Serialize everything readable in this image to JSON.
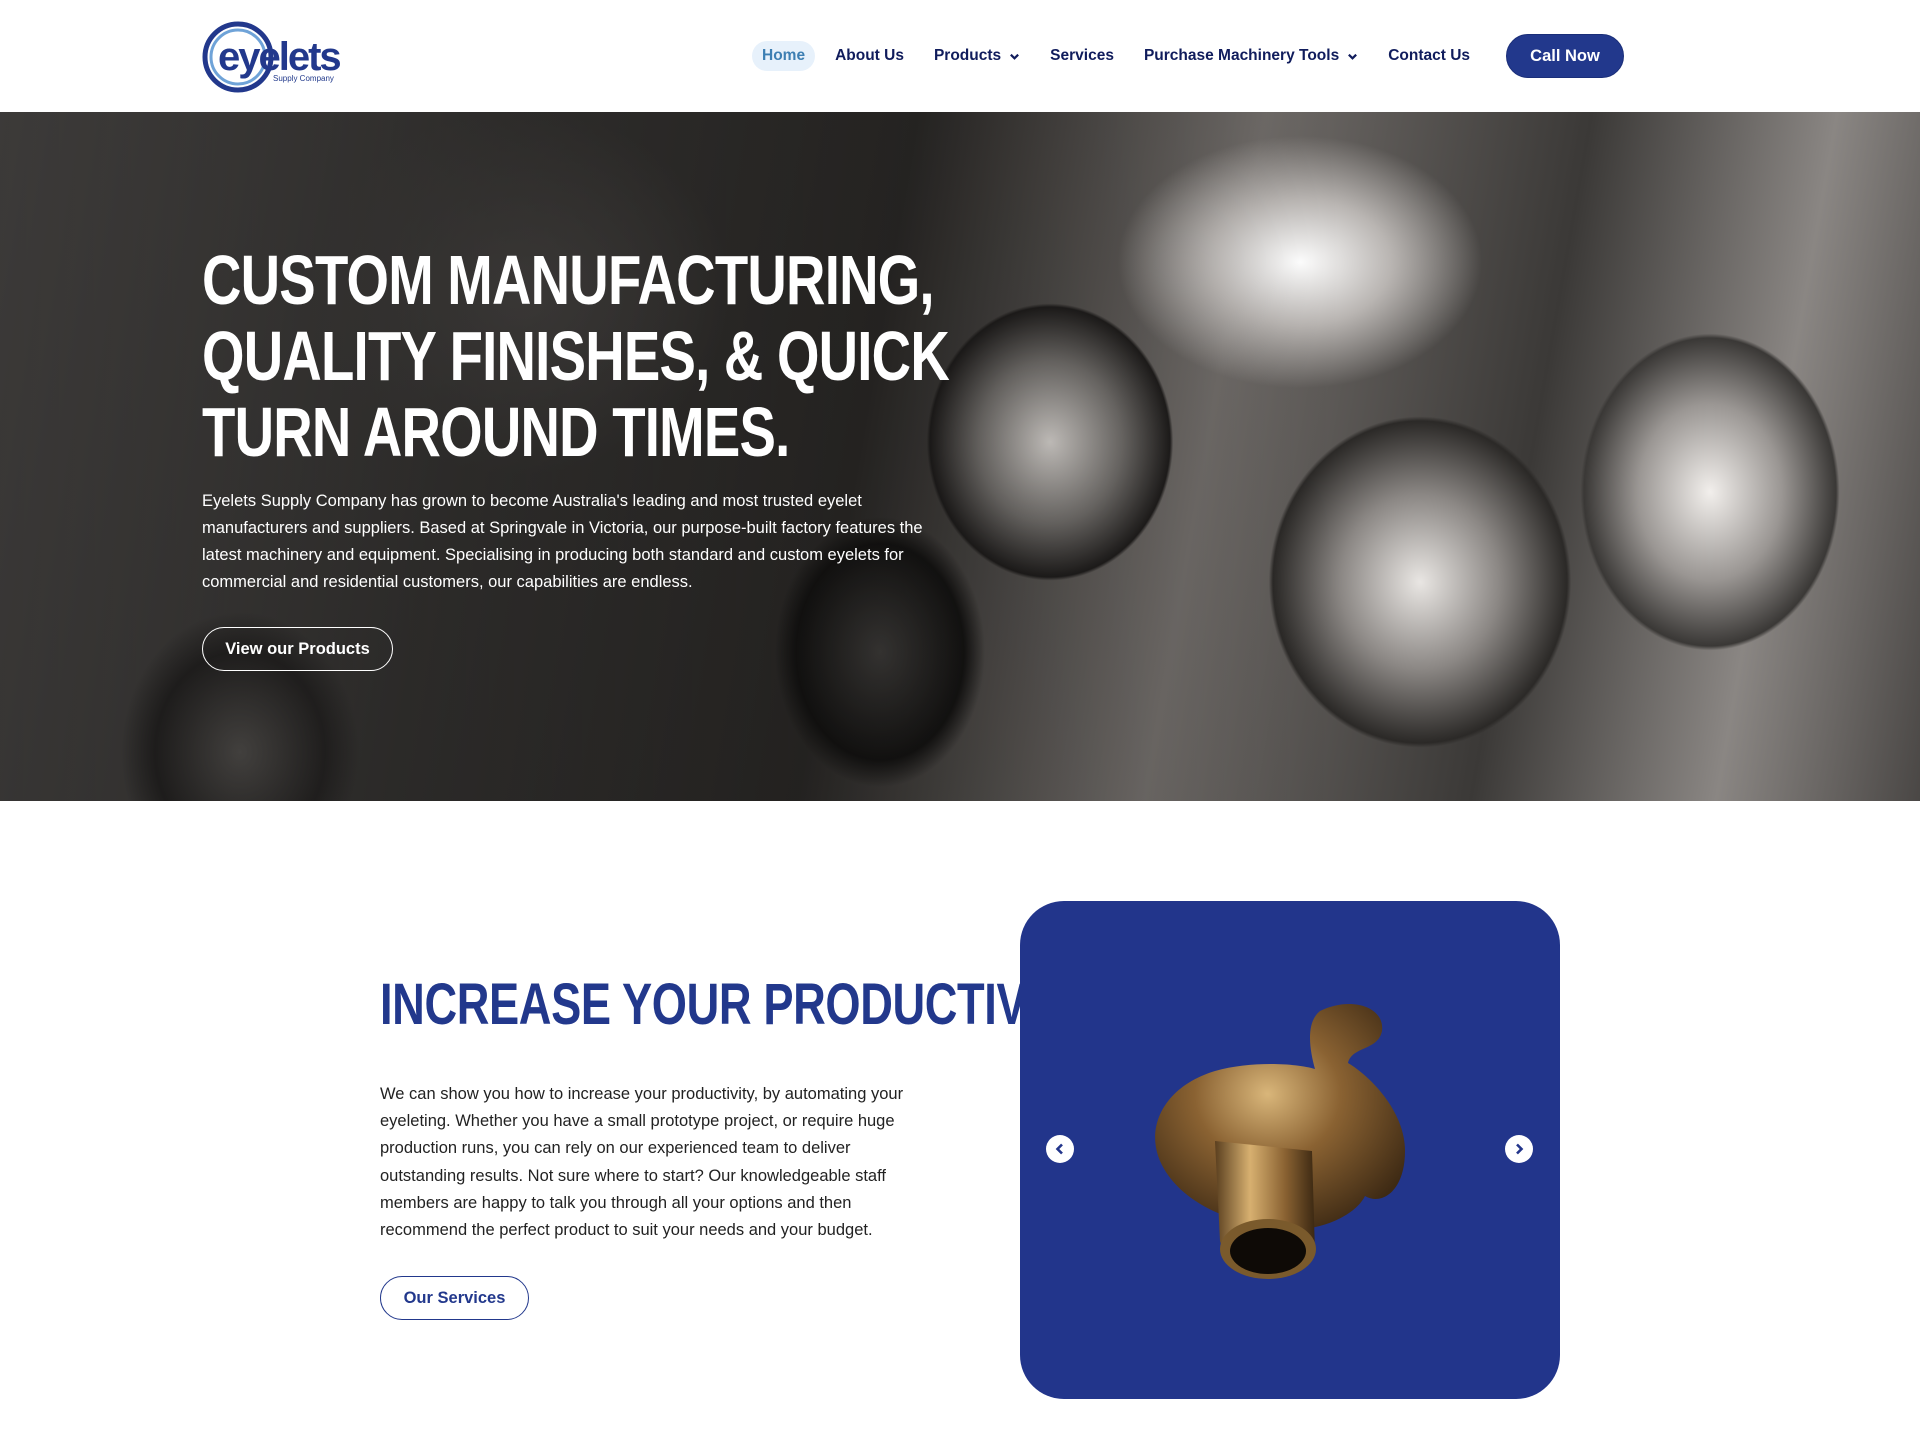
{
  "header": {
    "logo_text": "eyelets",
    "logo_subtext": "Supply Company",
    "nav": [
      {
        "label": "Home",
        "active": true,
        "dropdown": false
      },
      {
        "label": "About Us",
        "active": false,
        "dropdown": false
      },
      {
        "label": "Products",
        "active": false,
        "dropdown": true
      },
      {
        "label": "Services",
        "active": false,
        "dropdown": false
      },
      {
        "label": "Purchase Machinery Tools",
        "active": false,
        "dropdown": true
      },
      {
        "label": "Contact Us",
        "active": false,
        "dropdown": false
      }
    ],
    "cta_label": "Call Now"
  },
  "hero": {
    "title_lines": [
      "CUSTOM MANUFACTURING,",
      "QUALITY FINISHES, & QUICK",
      "TURN AROUND TIMES."
    ],
    "text": "Eyelets Supply Company has grown to become Australia's leading and most trusted eyelet manufacturers and suppliers. Based at Springvale in Victoria, our purpose-built factory features the latest machinery and equipment. Specialising in producing both standard and custom eyelets for commercial and residential customers, our capabilities are endless.",
    "button_label": "View our Products"
  },
  "productivity": {
    "title": "INCREASE YOUR PRODUCTIVITY",
    "text": "We can show you how to increase your productivity, by automating your eyeleting. Whether you have a small prototype project, or require huge production runs, you can rely on our experienced team to deliver outstanding results. Not sure where to start? Our knowledgeable staff members are happy to talk you through all your options and then recommend the perfect product to suit your needs and your budget.",
    "button_label": "Our Services"
  },
  "carousel": {
    "prev_icon": "chevron-left-icon",
    "next_icon": "chevron-right-icon",
    "slide_image": "brass-eyelet-image"
  },
  "colors": {
    "brand_blue": "#22388c",
    "nav_text": "#101c5c",
    "active_nav_bg": "#e7f1fb",
    "active_nav_text": "#3d7fb3"
  }
}
